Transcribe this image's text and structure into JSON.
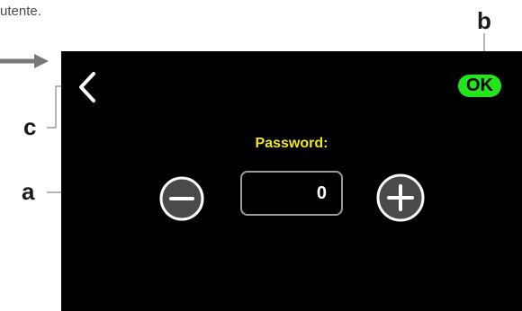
{
  "caption": "utente.",
  "screen": {
    "ok_label": "OK",
    "password_label": "Password:",
    "password_value": "0"
  },
  "callouts": {
    "a": "a",
    "b": "b",
    "c": "c"
  },
  "colors": {
    "ok_button": "#22e51a",
    "password_label": "#f0e81a",
    "screen_background": "#000000"
  },
  "icons": {
    "back": "chevron-left-icon",
    "minus": "minus-circle-icon",
    "plus": "plus-circle-icon",
    "pointer": "arrow-right-icon"
  }
}
